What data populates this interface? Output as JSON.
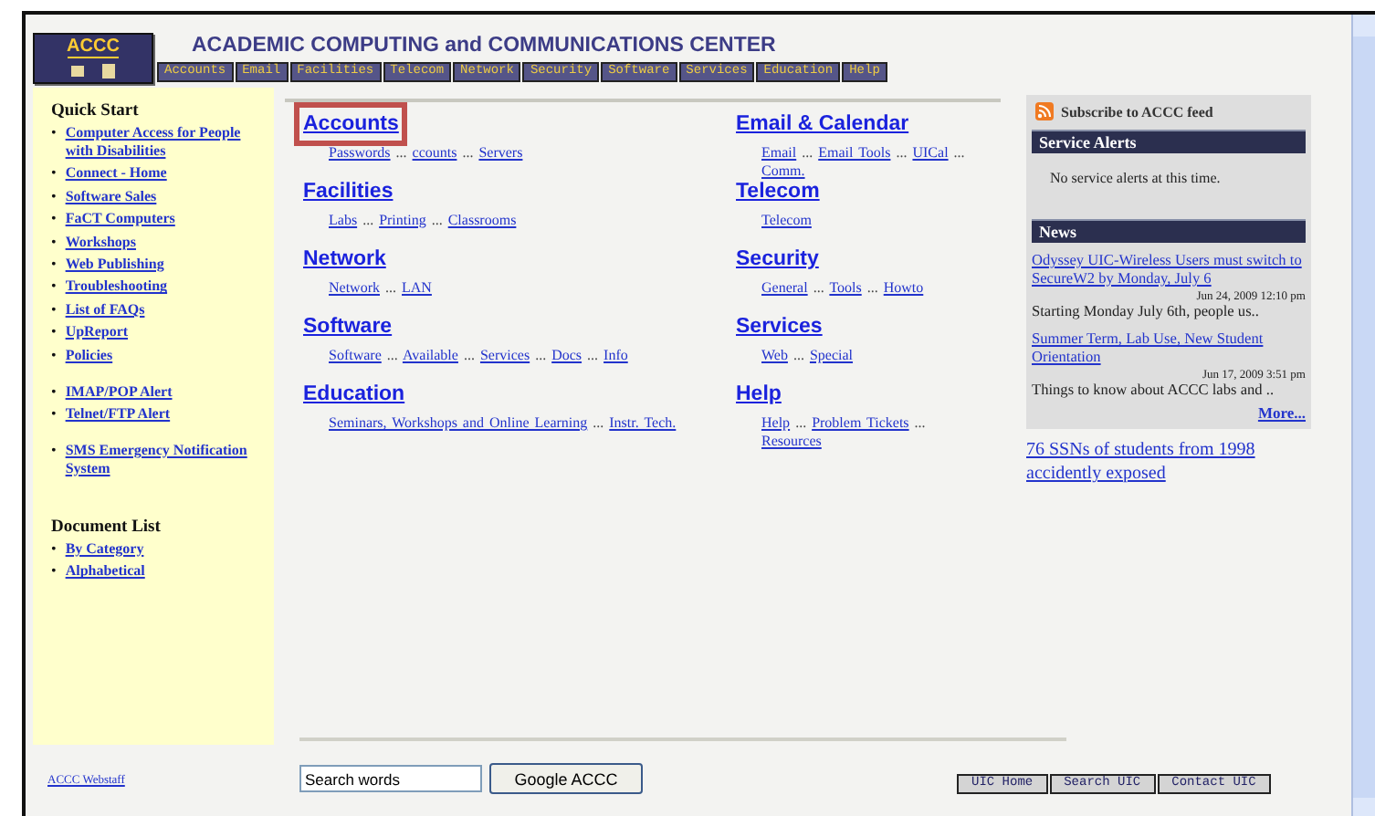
{
  "header": {
    "logo": "ACCC",
    "title": "ACADEMIC COMPUTING and COMMUNICATIONS CENTER",
    "nav": [
      "Accounts",
      "Email",
      "Facilities",
      "Telecom",
      "Network",
      "Security",
      "Software",
      "Services",
      "Education",
      "Help"
    ]
  },
  "quick_start": {
    "title": "Quick Start",
    "groups": [
      [
        {
          "bullet": "•",
          "text": "Computer Access for People with Disabilities"
        },
        {
          "bullet": "•",
          "text": "Connect - Home"
        },
        {
          "bullet": "•",
          "text": "Software Sales"
        },
        {
          "bullet": "•",
          "text": "FaCT Computers"
        },
        {
          "bullet": "•",
          "text": "Workshops"
        },
        {
          "bullet": "•",
          "text": "Web Publishing"
        },
        {
          "bullet": "•",
          "text": "Troubleshooting"
        },
        {
          "bullet": "•",
          "text": "List of FAQs"
        },
        {
          "bullet": "•",
          "text": "UpReport"
        },
        {
          "bullet": "•",
          "text": "Policies"
        }
      ],
      [
        {
          "bullet": "•",
          "text": "IMAP/POP Alert"
        },
        {
          "bullet": "•",
          "text": "Telnet/FTP Alert"
        }
      ],
      [
        {
          "bullet": "•",
          "text": "SMS Emergency Notification System"
        }
      ]
    ]
  },
  "document_list": {
    "title": "Document List",
    "items": [
      {
        "bullet": "•",
        "text": "By Category"
      },
      {
        "bullet": "•",
        "text": "Alphabetical"
      }
    ]
  },
  "sections": [
    {
      "title": "Accounts",
      "highlighted": true,
      "links": [
        {
          "kind": "link",
          "text": "Passwords"
        },
        {
          "kind": "sep",
          "text": "..."
        },
        {
          "kind": "link",
          "text": "ccounts"
        },
        {
          "kind": "sep",
          "text": "..."
        },
        {
          "kind": "link",
          "text": "Servers"
        }
      ]
    },
    {
      "title": "Email & Calendar",
      "highlighted": false,
      "links": [
        {
          "kind": "link",
          "text": "Email"
        },
        {
          "kind": "sep",
          "text": "..."
        },
        {
          "kind": "link",
          "text": "Email Tools"
        },
        {
          "kind": "sep",
          "text": "..."
        },
        {
          "kind": "link",
          "text": "UICal"
        },
        {
          "kind": "sep",
          "text": "..."
        },
        {
          "kind": "link",
          "text": "Comm."
        }
      ]
    },
    {
      "title": "Facilities",
      "highlighted": false,
      "links": [
        {
          "kind": "link",
          "text": "Labs"
        },
        {
          "kind": "sep",
          "text": "..."
        },
        {
          "kind": "link",
          "text": "Printing"
        },
        {
          "kind": "sep",
          "text": "..."
        },
        {
          "kind": "link",
          "text": "Classrooms"
        }
      ]
    },
    {
      "title": "Telecom",
      "highlighted": false,
      "links": [
        {
          "kind": "link",
          "text": "Telecom"
        }
      ]
    },
    {
      "title": "Network",
      "highlighted": false,
      "links": [
        {
          "kind": "link",
          "text": "Network"
        },
        {
          "kind": "sep",
          "text": "..."
        },
        {
          "kind": "link",
          "text": "LAN"
        }
      ]
    },
    {
      "title": "Security",
      "highlighted": false,
      "links": [
        {
          "kind": "link",
          "text": "General"
        },
        {
          "kind": "sep",
          "text": "..."
        },
        {
          "kind": "link",
          "text": "Tools"
        },
        {
          "kind": "sep",
          "text": "..."
        },
        {
          "kind": "link",
          "text": "Howto"
        }
      ]
    },
    {
      "title": "Software",
      "highlighted": false,
      "links": [
        {
          "kind": "link",
          "text": "Software"
        },
        {
          "kind": "sep",
          "text": "..."
        },
        {
          "kind": "link",
          "text": "Available"
        },
        {
          "kind": "sep",
          "text": "..."
        },
        {
          "kind": "link",
          "text": "Services"
        },
        {
          "kind": "sep",
          "text": "..."
        },
        {
          "kind": "link",
          "text": "Docs"
        },
        {
          "kind": "sep",
          "text": "..."
        },
        {
          "kind": "link",
          "text": "Info"
        }
      ]
    },
    {
      "title": "Services",
      "highlighted": false,
      "links": [
        {
          "kind": "link",
          "text": "Web"
        },
        {
          "kind": "sep",
          "text": "..."
        },
        {
          "kind": "link",
          "text": "Special"
        }
      ]
    },
    {
      "title": "Education",
      "highlighted": false,
      "links": [
        {
          "kind": "link",
          "text": "Seminars, Workshops and Online Learning"
        },
        {
          "kind": "sep",
          "text": "..."
        },
        {
          "kind": "link",
          "text": "Instr. Tech."
        }
      ]
    },
    {
      "title": "Help",
      "highlighted": false,
      "links": [
        {
          "kind": "link",
          "text": "Help"
        },
        {
          "kind": "sep",
          "text": "..."
        },
        {
          "kind": "link",
          "text": "Problem Tickets"
        },
        {
          "kind": "sep",
          "text": "..."
        },
        {
          "kind": "link",
          "text": "Resources"
        }
      ]
    }
  ],
  "side_panel": {
    "subscribe": "Subscribe to ACCC feed",
    "alerts_title": "Service Alerts",
    "alerts_text": "No service alerts at this time.",
    "news_title": "News",
    "news": [
      {
        "title": "Odyssey UIC-Wireless Users must switch to SecureW2 by Monday, July 6",
        "date": "Jun 24, 2009 12:10 pm",
        "snippet": "Starting Monday July 6th, people us.."
      },
      {
        "title": "Summer Term, Lab Use, New Student Orientation",
        "date": "Jun 17, 2009 3:51 pm",
        "snippet": "Things to know about ACCC labs and .."
      }
    ],
    "more": "More...",
    "headline": "76 SSNs of students from 1998 accidently exposed"
  },
  "footer": {
    "search_value": "Search words",
    "search_button": "Google ACCC",
    "webstaff": "ACCC Webstaff",
    "buttons": [
      "UIC Home",
      "Search UIC",
      "Contact UIC"
    ]
  }
}
